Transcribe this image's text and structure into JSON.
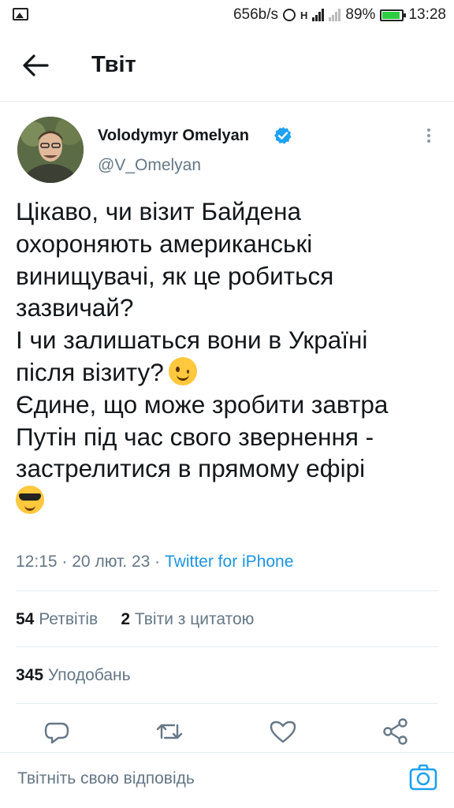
{
  "status_bar": {
    "speed": "656b/s",
    "network": "H",
    "battery_percent": "89%",
    "time": "13:28",
    "battery_level": 0.89
  },
  "header": {
    "title": "Твіт",
    "back_icon": "arrow-left-icon"
  },
  "tweet": {
    "author_name": "Volodymyr Omelyan",
    "handle": "@V_Omelyan",
    "verified": true,
    "lines": [
      "Цікаво, чи візит Байдена",
      "охороняють американські",
      "винищувачі, як це робиться",
      "зазвичай?",
      "І чи залишаться вони в Україні",
      "після візиту?",
      "Єдине, що може зробити завтра",
      "Путін під час свого звернення -",
      "застрелитися в прямому ефірі"
    ],
    "emojis": [
      "winking-face",
      "smiling-face-with-sunglasses"
    ],
    "time": "12:15",
    "date": "20 лют. 23",
    "source": "Twitter for iPhone",
    "separator": "·"
  },
  "stats": {
    "retweets_count": "54",
    "retweets_label": "Ретвітів",
    "quotes_count": "2",
    "quotes_label": "Твіти з цитатою",
    "likes_count": "345",
    "likes_label": "Уподобань"
  },
  "actions": [
    "reply-icon",
    "retweet-icon",
    "like-icon",
    "share-icon"
  ],
  "reply": {
    "placeholder": "Твітніть свою відповідь",
    "camera_icon": "camera-icon"
  },
  "colors": {
    "accent": "#1b95e0",
    "secondary_text": "#657786",
    "text": "#14171a",
    "divider": "#e6ecf0"
  }
}
